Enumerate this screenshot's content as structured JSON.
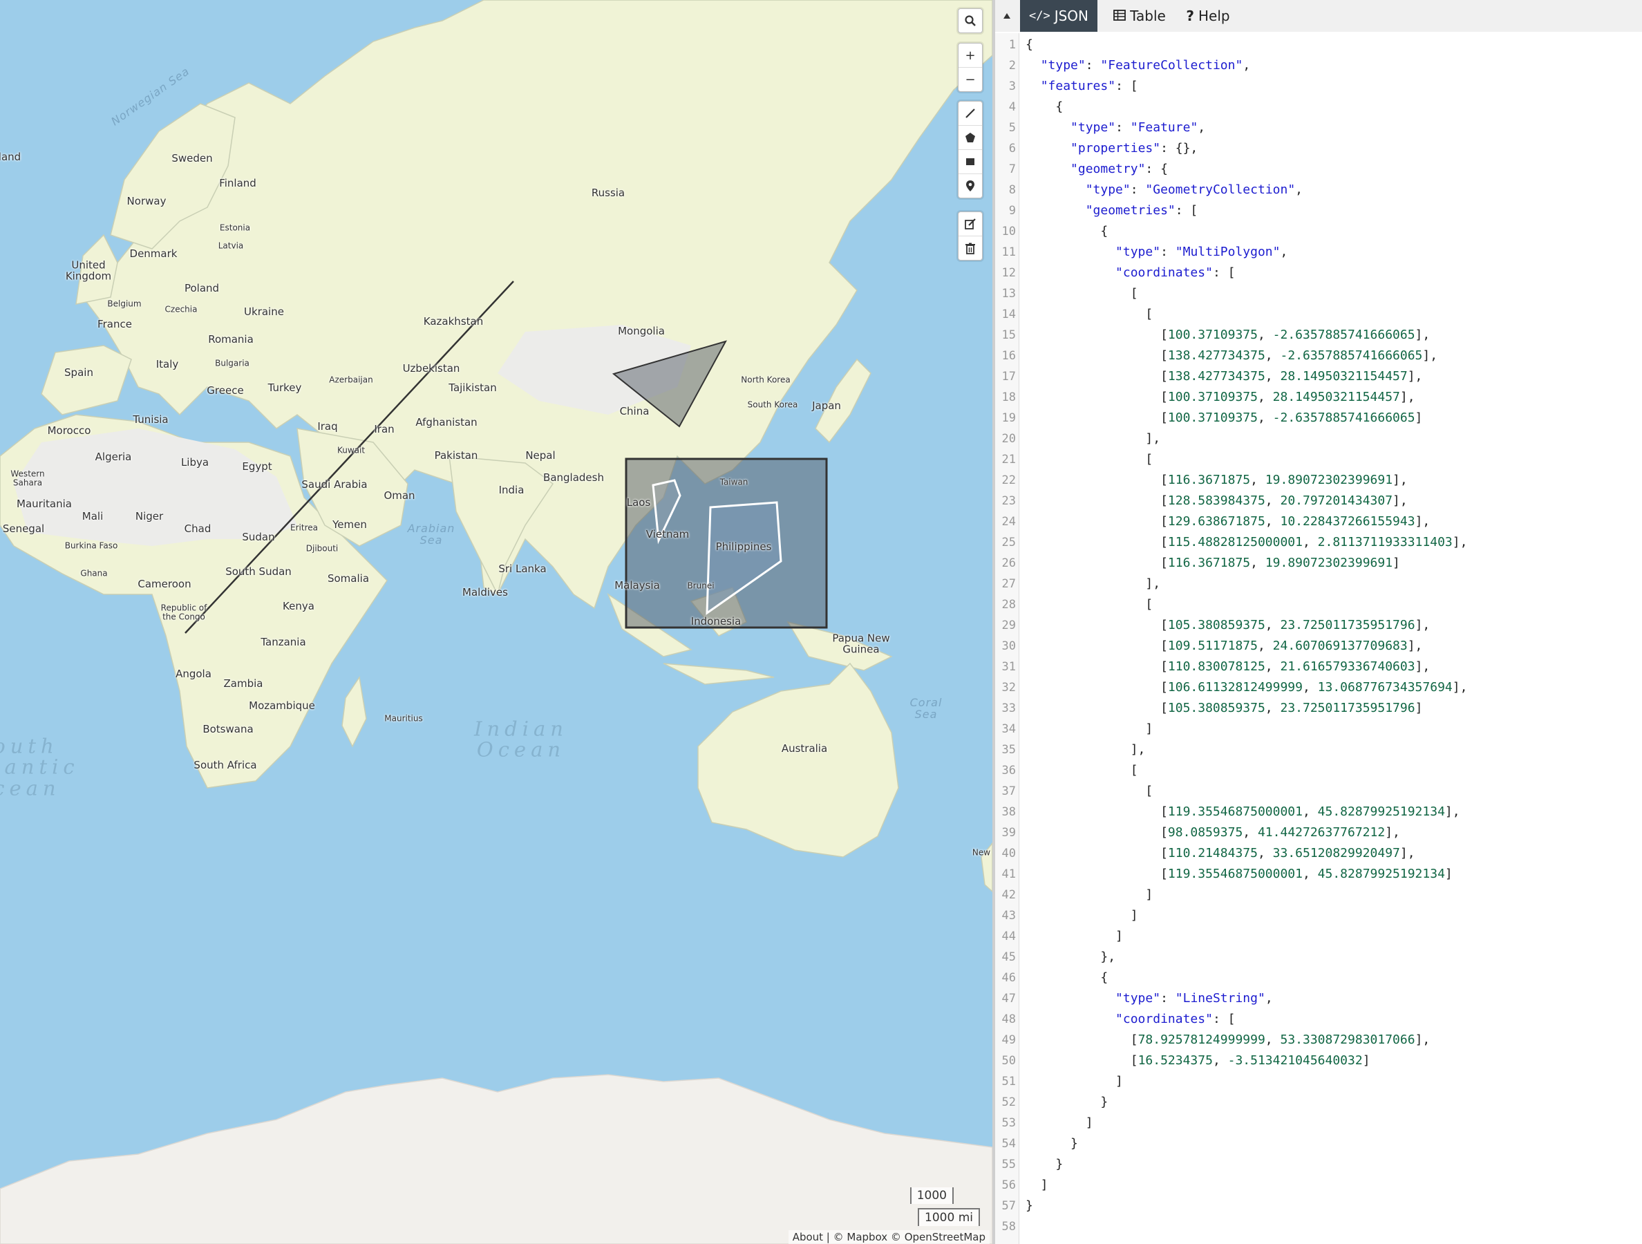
{
  "map": {
    "controls": {
      "search_icon": "search-icon",
      "zoom_in_label": "+",
      "zoom_out_label": "−",
      "draw_tools": [
        "draw-line-icon",
        "draw-polygon-icon",
        "draw-rectangle-icon",
        "draw-marker-icon"
      ],
      "edit_tools": [
        "edit-icon",
        "trash-icon"
      ]
    },
    "scale": {
      "km": "1000",
      "mi": "1000 mi"
    },
    "attribution": "About | © Mapbox © OpenStreetMap",
    "colors": {
      "water": "#9dcdea",
      "land": "#f0f3d6",
      "land_gray": "#ececea",
      "overlay": "#555e68"
    },
    "labels": {
      "countries": [
        "Sweden",
        "Finland",
        "Norway",
        "Estonia",
        "Latvia",
        "Denmark",
        "United Kingdom",
        "Belgium",
        "Poland",
        "Czechia",
        "Ukraine",
        "France",
        "Romania",
        "Bulgaria",
        "Italy",
        "Spain",
        "Greece",
        "Turkey",
        "Azerbaijan",
        "Kazakhstan",
        "Uzbekistan",
        "Tajikistan",
        "Russia",
        "Mongolia",
        "North Korea",
        "South Korea",
        "Japan",
        "China",
        "Taiwan",
        "Laos",
        "Vietnam",
        "Philippines",
        "Malaysia",
        "Brunei",
        "Indonesia",
        "Papua New Guinea",
        "Australia",
        "Morocco",
        "Tunisia",
        "Algeria",
        "Libya",
        "Egypt",
        "Western Sahara",
        "Mauritania",
        "Mali",
        "Niger",
        "Chad",
        "Senegal",
        "Burkina Faso",
        "Ghana",
        "Sudan",
        "Eritrea",
        "Djibouti",
        "South Sudan",
        "Cameroon",
        "Republic of the Congo",
        "Kenya",
        "Somalia",
        "Tanzania",
        "Angola",
        "Zambia",
        "Mozambique",
        "Botswana",
        "South Africa",
        "Iraq",
        "Iran",
        "Kuwait",
        "Saudi Arabia",
        "Oman",
        "Yemen",
        "Afghanistan",
        "Pakistan",
        "Nepal",
        "India",
        "Bangladesh",
        "Sri Lanka",
        "Maldives",
        "Mauritius",
        "land"
      ],
      "seas": [
        "Norwegian Sea",
        "Arabian Sea",
        "Coral Sea"
      ],
      "oceans": [
        "Indian Ocean",
        "outh lantic cean"
      ],
      "edge": [
        "New"
      ]
    }
  },
  "panel": {
    "collapse_icon": "caret-up-icon",
    "tabs": [
      {
        "icon": "code-icon",
        "label": "JSON",
        "active": true
      },
      {
        "icon": "table-icon",
        "label": "Table",
        "active": false
      },
      {
        "icon": "help-icon",
        "label": "Help",
        "active": false
      }
    ]
  },
  "editor": {
    "lines": [
      "{",
      "  \"type\": \"FeatureCollection\",",
      "  \"features\": [",
      "    {",
      "      \"type\": \"Feature\",",
      "      \"properties\": {},",
      "      \"geometry\": {",
      "        \"type\": \"GeometryCollection\",",
      "        \"geometries\": [",
      "          {",
      "            \"type\": \"MultiPolygon\",",
      "            \"coordinates\": [",
      "              [",
      "                [",
      "                  [100.37109375, -2.6357885741666065],",
      "                  [138.427734375, -2.6357885741666065],",
      "                  [138.427734375, 28.14950321154457],",
      "                  [100.37109375, 28.14950321154457],",
      "                  [100.37109375, -2.6357885741666065]",
      "                ],",
      "                [",
      "                  [116.3671875, 19.89072302399691],",
      "                  [128.583984375, 20.797201434307],",
      "                  [129.638671875, 10.228437266155943],",
      "                  [115.48828125000001, 2.8113711933311403],",
      "                  [116.3671875, 19.89072302399691]",
      "                ],",
      "                [",
      "                  [105.380859375, 23.725011735951796],",
      "                  [109.51171875, 24.607069137709683],",
      "                  [110.830078125, 21.616579336740603],",
      "                  [106.61132812499999, 13.068776734357694],",
      "                  [105.380859375, 23.725011735951796]",
      "                ]",
      "              ],",
      "              [",
      "                [",
      "                  [119.35546875000001, 45.82879925192134],",
      "                  [98.0859375, 41.44272637767212],",
      "                  [110.21484375, 33.65120829920497],",
      "                  [119.35546875000001, 45.82879925192134]",
      "                ]",
      "              ]",
      "            ]",
      "          },",
      "          {",
      "            \"type\": \"LineString\",",
      "            \"coordinates\": [",
      "              [78.92578124999999, 53.330872983017066],",
      "              [16.5234375, -3.513421045640032]",
      "            ]",
      "          }",
      "        ]",
      "      }",
      "    }",
      "  ]",
      "}",
      ""
    ]
  }
}
